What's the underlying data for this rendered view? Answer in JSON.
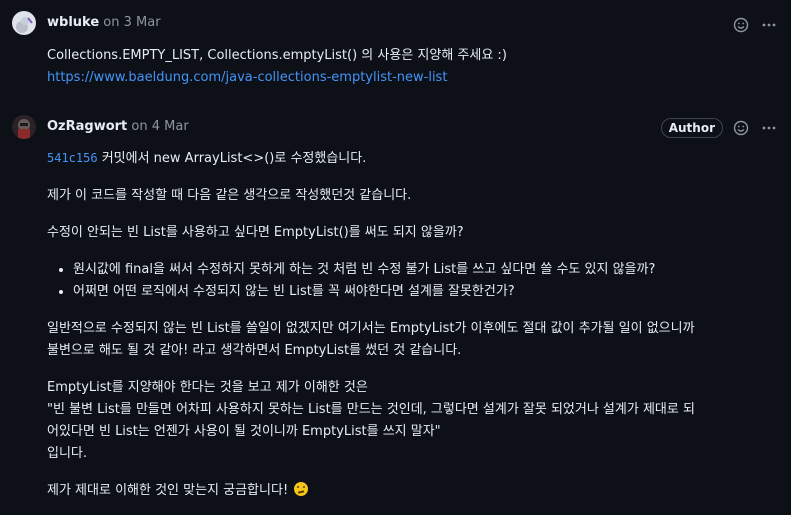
{
  "comments": [
    {
      "author": "wbluke",
      "date": "on 3 Mar",
      "body_text": "Collections.EMPTY_LIST, Collections.emptyList() 의 사용은 지양해 주세요 :)",
      "link": "https://www.baeldung.com/java-collections-emptylist-new-list",
      "icons": [
        "smiley-icon",
        "kebab-menu-icon"
      ]
    },
    {
      "author": "OzRagwort",
      "date": "on 4 Mar",
      "badge": "Author",
      "commit_hash": "541c156",
      "line1_rest": " 커밋에서 new ArrayList<>()로 수정했습니다.",
      "p2": "제가 이 코드를 작성할 때 다음 같은 생각으로 작성했던것 같습니다.",
      "p3": "수정이 안되는 빈 List를 사용하고 싶다면 EmptyList()를 써도 되지 않을까?",
      "bullets": [
        "원시값에 final을 써서 수정하지 못하게 하는 것 처럼 빈 수정 불가 List를 쓰고 싶다면 쓸 수도 있지 않을까?",
        "어쩌면 어떤 로직에서 수정되지 않는 빈 List를 꼭 써야한다면 설계를 잘못한건가?"
      ],
      "p4_line1": "일반적으로 수정되지 않는 빈 List를 쓸일이 없겠지만 여기서는 EmptyList가 이후에도 절대 값이 추가될 일이 없으니까",
      "p4_line2": "불변으로 해도 될 것 같아! 라고 생각하면서 EmptyList를 썼던 것 같습니다.",
      "p5_line1": "EmptyList를 지양해야 한다는 것을 보고 제가 이해한 것은",
      "p5_line2": "\"빈 불변 List를 만들면 어차피 사용하지 못하는 List를 만드는 것인데, 그렇다면 설계가 잘못 되었거나 설계가 제대로 되",
      "p5_line3": "어있다면 빈 List는 언젠가 사용이 될 것이니까 EmptyList를 쓰지 말자\"",
      "p5_line4": "입니다.",
      "p6": "제가 제대로 이해한 것인 맞는지 궁금합니다!",
      "emoji": "thinking-face-icon",
      "icons": [
        "smiley-icon",
        "kebab-menu-icon"
      ]
    }
  ],
  "colors": {
    "background": "#0d1117",
    "text": "#e6edf3",
    "muted": "#8d96a0",
    "link": "#4493f8"
  }
}
